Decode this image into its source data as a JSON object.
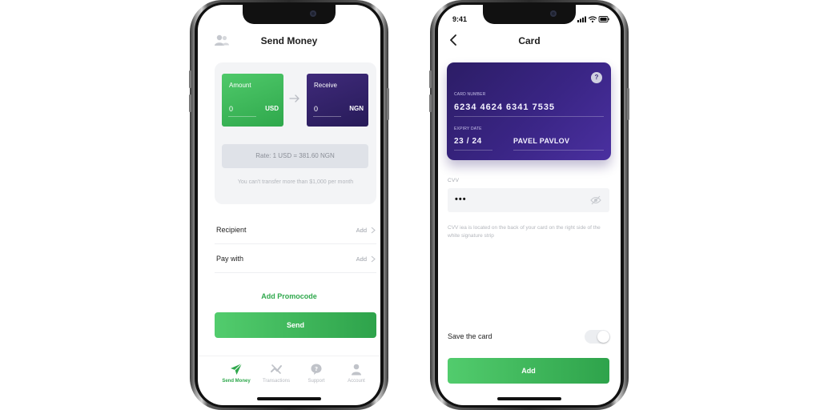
{
  "send_money": {
    "title": "Send Money",
    "header_icon": "users-icon",
    "amount": {
      "label": "Amount",
      "value": "0",
      "currency": "USD",
      "color": "#3dba5c"
    },
    "receive": {
      "label": "Receive",
      "value": "0",
      "currency": "NGN",
      "color": "#2f2068"
    },
    "rate": "Rate: 1 USD = 381.60 NGN",
    "limit_note": "You can't transfer more than $1,000 per month",
    "rows": [
      {
        "label": "Recipient",
        "action": "Add"
      },
      {
        "label": "Pay with",
        "action": "Add"
      }
    ],
    "promo_label": "Add Promocode",
    "send_label": "Send",
    "tabs": [
      {
        "label": "Send Money",
        "icon": "paper-plane-icon",
        "active": true
      },
      {
        "label": "Transactions",
        "icon": "transactions-icon",
        "active": false
      },
      {
        "label": "Support",
        "icon": "support-icon",
        "active": false
      },
      {
        "label": "Account",
        "icon": "account-icon",
        "active": false
      }
    ]
  },
  "card_screen": {
    "status_time": "9:41",
    "title": "Card",
    "card": {
      "number_label": "CARD NUMBER",
      "number": "6234  4624  6341  7535",
      "expiry_label": "EXPIRY DATE",
      "expiry": "23 / 24",
      "holder": "PAVEL PAVLOV",
      "help": "?",
      "gradient_color": "#3a2585"
    },
    "cvv_label": "CVV",
    "cvv_value": "•••",
    "cvv_hint": "CVV iea is located on the back of your card on the right side of the white signature strip",
    "save_label": "Save the card",
    "save_toggle_on": false,
    "add_label": "Add"
  },
  "colors": {
    "accent_green": "#2fa84c",
    "card_purple": "#2f2068"
  }
}
